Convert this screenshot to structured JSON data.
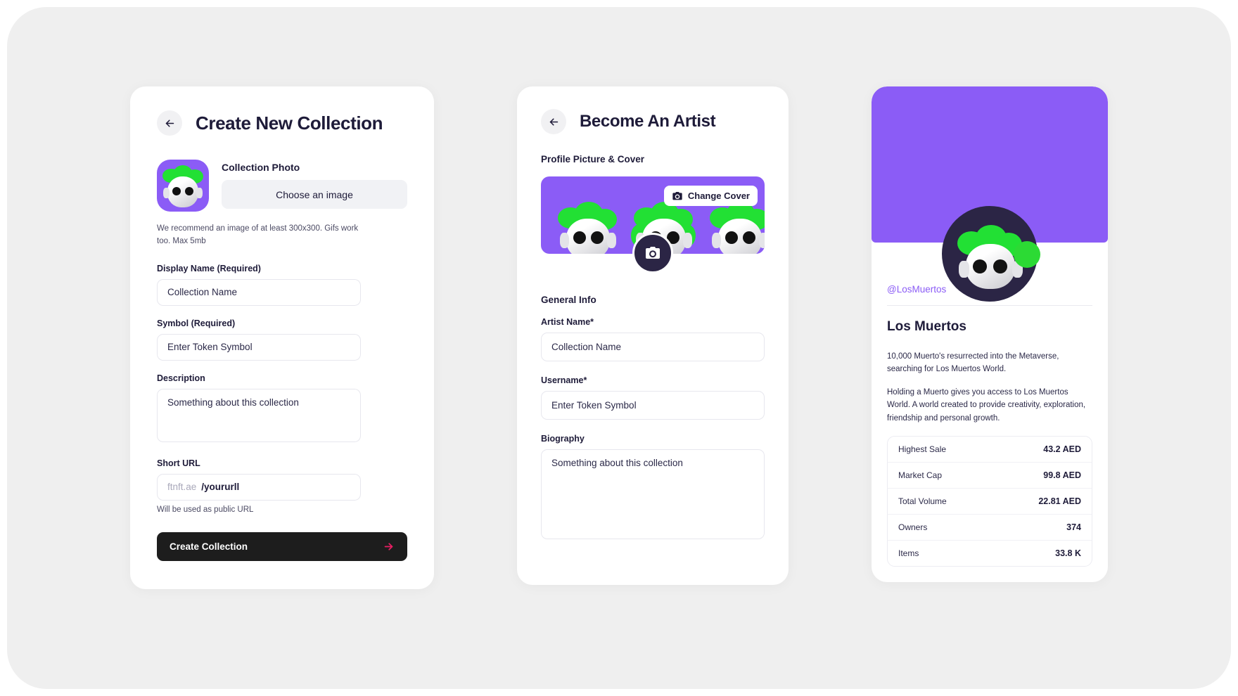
{
  "theme": {
    "background": "#ffffff",
    "panel": "#efefef",
    "card": "#ffffff",
    "accent_purple": "#8b5cf6",
    "accent_green": "#2cda34",
    "accent_pink": "#e91e63",
    "dark": "#1d1d1d",
    "text": "#1e1b39"
  },
  "create_collection": {
    "back_icon": "arrow-left-icon",
    "title": "Create New Collection",
    "photo": {
      "label": "Collection Photo",
      "choose_button": "Choose an image",
      "hint": "We recommend an image of at least 300x300. Gifs work too. Max 5mb"
    },
    "fields": {
      "display_name_label": "Display Name (Required)",
      "display_name_placeholder": "Collection Name",
      "display_name_value": "",
      "symbol_label": "Symbol (Required)",
      "symbol_placeholder": "Enter Token Symbol",
      "symbol_value": "",
      "description_label": "Description",
      "description_placeholder": "Something about this collection",
      "description_value": "",
      "short_url_label": "Short URL",
      "short_url_prefix": "ftnft.ae",
      "short_url_placeholder": "/yoururll",
      "short_url_value": "",
      "short_url_helper": "Will be used as public URL"
    },
    "submit_label": "Create Collection",
    "submit_icon": "arrow-right-icon"
  },
  "become_artist": {
    "back_icon": "arrow-left-icon",
    "title": "Become An Artist",
    "cover_section_label": "Profile Picture & Cover",
    "change_cover_label": "Change Cover",
    "change_cover_icon": "camera-icon",
    "avatar_upload_icon": "camera-icon",
    "general_info_label": "General Info",
    "fields": {
      "artist_name_label": "Artist Name*",
      "artist_name_placeholder": "Collection Name",
      "artist_name_value": "",
      "username_label": "Username*",
      "username_placeholder": "Enter Token Symbol",
      "username_value": "",
      "biography_label": "Biography",
      "biography_placeholder": "Something about this collection",
      "biography_value": ""
    }
  },
  "profile_preview": {
    "handle": "@LosMuertos",
    "name": "Los Muertos",
    "bio_paragraph_1": "10,000 Muerto's resurrected into the Metaverse, searching for Los Muertos World.",
    "bio_paragraph_2": "Holding a Muerto gives you access to Los Muertos World. A world created to provide creativity, exploration, friendship and personal growth.",
    "stats": [
      {
        "label": "Highest Sale",
        "value": "43.2 AED"
      },
      {
        "label": "Market Cap",
        "value": "99.8 AED"
      },
      {
        "label": "Total Volume",
        "value": "22.81 AED"
      },
      {
        "label": "Owners",
        "value": "374"
      },
      {
        "label": "Items",
        "value": "33.8 K"
      }
    ]
  }
}
